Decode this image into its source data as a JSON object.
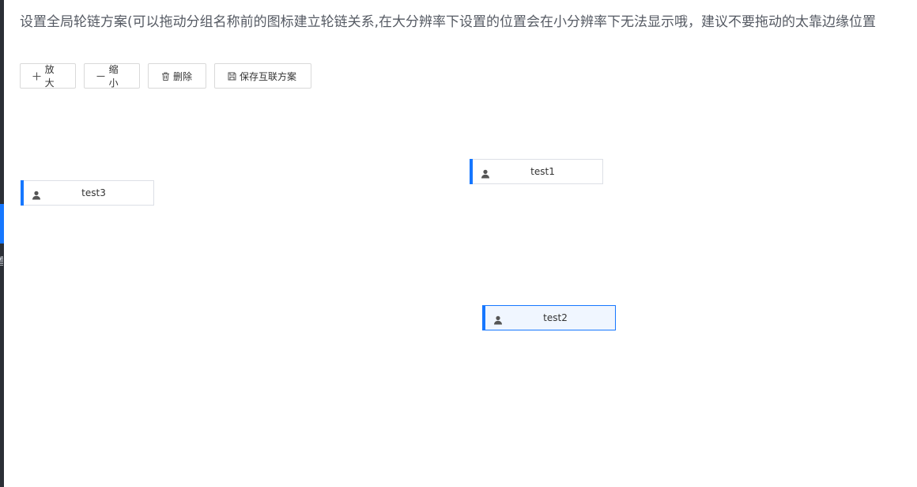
{
  "hint_text": "设置全局轮链方案(可以拖动分组名称前的图标建立轮链关系,在大分辨率下设置的位置会在小分辨率下无法显示哦，建议不要拖动的太靠边缘位置",
  "sidebar": {
    "glyph": "置",
    "accent_color": "#1677ff",
    "bg_color": "#2b2f36"
  },
  "toolbar": {
    "zoom_in": {
      "label": "放大",
      "icon": "plus-icon"
    },
    "zoom_out": {
      "label": "缩小",
      "icon": "minus-icon"
    },
    "delete": {
      "label": "删除",
      "icon": "trash-icon"
    },
    "save": {
      "label": "保存互联方案",
      "icon": "save-icon"
    }
  },
  "canvas": {
    "nodes": [
      {
        "label": "test1",
        "icon": "user-icon",
        "selected": false
      },
      {
        "label": "test2",
        "icon": "user-icon",
        "selected": true
      },
      {
        "label": "test3",
        "icon": "user-icon",
        "selected": false
      }
    ]
  },
  "colors": {
    "accent": "#1677ff",
    "selected_bg": "#f0f6ff"
  }
}
